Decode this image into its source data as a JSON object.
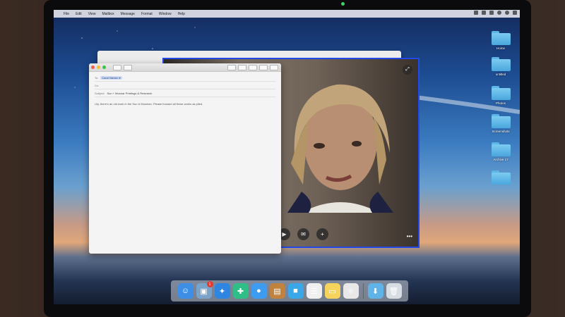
{
  "menubar": {
    "items": [
      "File",
      "Edit",
      "View",
      "Mailbox",
      "Message",
      "Format",
      "Window",
      "Help"
    ]
  },
  "desktop": {
    "folders": [
      "Home",
      "untitled",
      "Photos",
      "Screenshots",
      "Archive 17",
      ""
    ]
  },
  "mail": {
    "to_label": "To:",
    "to_chip": "Carol Nieven ▾",
    "cc_label": "Cc:",
    "subject_label": "Subject:",
    "subject": "Sun + Moonar Printings & Research",
    "body": "Lily, there's an old work in the Sun & Moonlan. Please forward all these works as piled."
  },
  "facetime": {
    "controls": [
      "camera-icon",
      "message-icon",
      "add-person-icon"
    ],
    "more_label": "•••",
    "expand_icon": "expand-icon"
  },
  "dock": {
    "apps": [
      {
        "name": "finder-icon",
        "color": "#3f8ee6",
        "glyph": "☺"
      },
      {
        "name": "preview-icon",
        "color": "#7aa3c9",
        "glyph": "▣",
        "badge": "1"
      },
      {
        "name": "safari-icon",
        "color": "#2f86e0",
        "glyph": "✦"
      },
      {
        "name": "health-icon",
        "color": "#2fbf86",
        "glyph": "✚"
      },
      {
        "name": "messages-icon",
        "color": "#3d9cf0",
        "glyph": "●"
      },
      {
        "name": "contacts-icon",
        "color": "#c0823c",
        "glyph": "▤"
      },
      {
        "name": "facetime-icon",
        "color": "#3aa8e8",
        "glyph": "■"
      },
      {
        "name": "reminders-icon",
        "color": "#f0f0f0",
        "glyph": "☰"
      },
      {
        "name": "notes-icon",
        "color": "#f5d35c",
        "glyph": "▭"
      },
      {
        "name": "system-icon",
        "color": "#e8e8e8",
        "glyph": "⚛"
      },
      {
        "name": "downloads-folder-icon",
        "color": "#5fb3e6",
        "glyph": "⬇"
      },
      {
        "name": "trash-icon",
        "color": "#d8dde3",
        "glyph": "🗑"
      }
    ]
  },
  "colors": {
    "accent": "#2348e8",
    "folder": "#5cb6e6"
  }
}
